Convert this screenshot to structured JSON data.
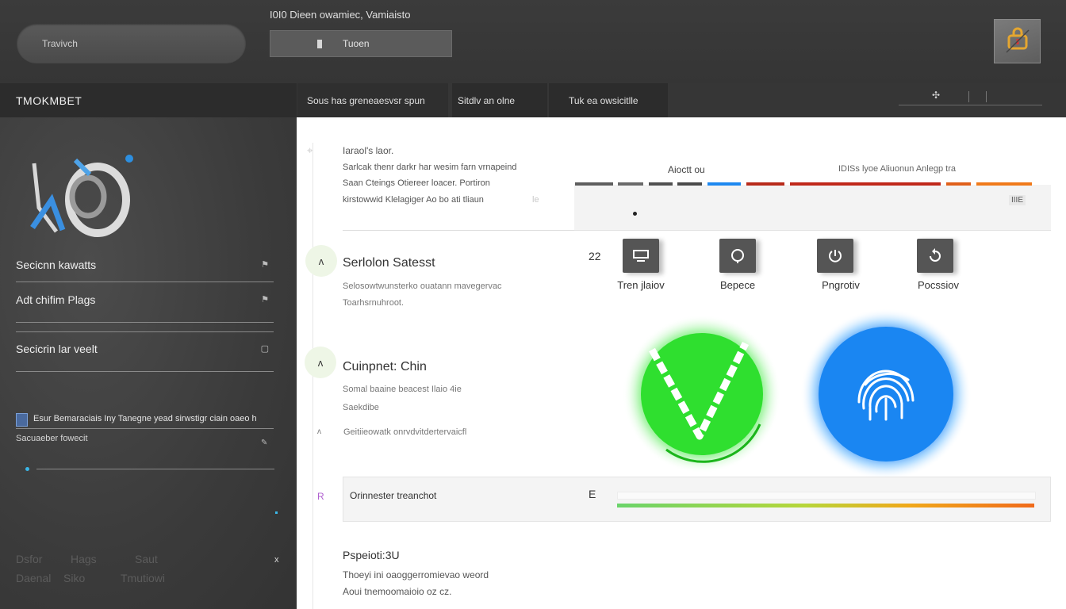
{
  "header": {
    "search_placeholder": "Travivch",
    "app_title": "I0I0 Dieen owamiec, Vamiaisto",
    "top_button_label": "Tuoen",
    "badge_icon": "alert-badge-icon"
  },
  "tabs": {
    "sidebar_title": "TMOKMBET",
    "items": [
      {
        "label": "Sous has greneaesvsr spun"
      },
      {
        "label": "Sitdlv an olne"
      },
      {
        "label": "Tuk ea owsicitlle"
      }
    ]
  },
  "sidebar": {
    "items": [
      {
        "label": "Secicnn kawatts",
        "icon": "flag-icon"
      },
      {
        "label": "Adt chifim Plags",
        "icon": "flag-icon"
      },
      {
        "label": "Secicrin lar veelt",
        "icon": "square-icon"
      }
    ],
    "checkbox_label": "Esur Bemaraciais Iny Tanegne yead sirwstigr ciain oaeo h",
    "sub_label": "Sacuaeber fowecit",
    "footer": {
      "col1": [
        "Dsfor",
        "Daenal"
      ],
      "col2": [
        "Hags",
        "Siko"
      ],
      "col3": [
        "Saut",
        "Tmutiowi"
      ],
      "close": "x"
    }
  },
  "main": {
    "section1": {
      "kicker": "Iaraol's laor.",
      "lines": [
        "Sarlcak thenr darkr har wesim farn vrnapeind",
        "Saan Cteings Otiereer loacer. Portiron",
        "kirstowwid Klelagiger Ao bo ati tliaun"
      ],
      "side_note": "le",
      "indicator_title_1": "Aioctt ou",
      "indicator_title_2": "IDISs lyoe Aliuonun Anlegp tra",
      "indicator_badge": "IIIE"
    },
    "section2": {
      "bubble": "ʌ",
      "title": "Serlolon Satesst",
      "lines": [
        "Selosowtwunsterko ouatann mavegervac",
        "Toarhsrnuhroot."
      ],
      "count": "22",
      "actions": [
        {
          "label": "Tren jlaiov",
          "icon": "monitor-icon"
        },
        {
          "label": "Bepece",
          "icon": "shield-icon"
        },
        {
          "label": "Pngrotiv",
          "icon": "power-icon"
        },
        {
          "label": "Pocssiov",
          "icon": "refresh-icon"
        }
      ]
    },
    "section3": {
      "bubble": "ʌ",
      "title": "Cuinpnet: Chin",
      "lines": [
        "Somal baaine beacest Ilaio 4ie",
        "Saekdibe"
      ],
      "note_icon": "ʌ",
      "note": "Geitiieowatk onrvdvitdertervaicfl",
      "green_icon": "check-icon",
      "blue_icon": "fingerprint-icon"
    },
    "progress": {
      "icon": "R",
      "label": "Orinnester treanchot",
      "value_label": "E",
      "progress_fraction": 1.0
    },
    "section4": {
      "title": "Pspeioti:3U",
      "lines": [
        "Thoeyi ini oaoggerromievao weord",
        "Aoui tnemoomaioio oz cz."
      ]
    }
  },
  "colors": {
    "green": "#2be02b",
    "blue": "#1e88f0",
    "red": "#c0281a",
    "orange": "#f07a1a",
    "gradient_start": "#6ad46a",
    "gradient_end": "#f06a1a"
  }
}
